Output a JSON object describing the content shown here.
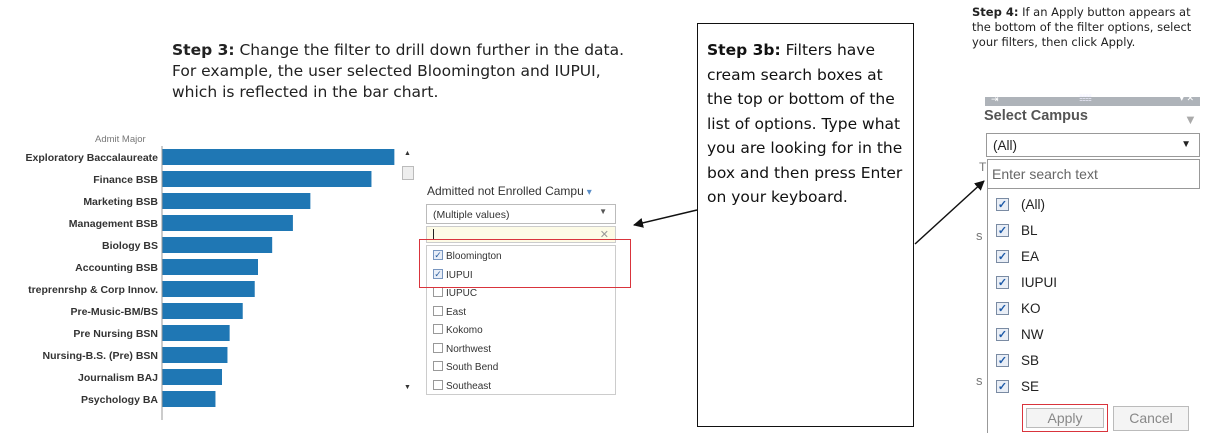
{
  "step3": {
    "label": "Step 3:",
    "text": " Change the filter to drill down further in the data.  For example, the user selected Bloomington and IUPUI, which is reflected in the bar chart."
  },
  "chart_data": {
    "type": "bar",
    "orientation": "horizontal",
    "title": "",
    "xlabel": "",
    "ylabel": "Admit Major",
    "categories": [
      "Exploratory Baccalaureate",
      "Finance BSB",
      "Marketing BSB",
      "Management BSB",
      "Biology BS",
      "Accounting BSB",
      "treprenrshp & Corp Innov.",
      "Pre-Music-BM/BS",
      "Pre Nursing BSN",
      "Nursing-B.S. (Pre) BSN",
      "Journalism BAJ",
      "Psychology BA"
    ],
    "values": [
      2130,
      1920,
      1360,
      1200,
      1010,
      880,
      850,
      740,
      620,
      600,
      550,
      490
    ],
    "xlim": [
      0,
      2200
    ],
    "xticks": [
      "0",
      "500",
      "1000",
      "1500",
      "2000"
    ],
    "bar_color": "#1f77b4",
    "grid": false
  },
  "filter": {
    "title": "Admitted not Enrolled Campu",
    "caret": "▾",
    "select_value": "(Multiple values)",
    "search_close": "✕",
    "items": [
      {
        "label": "Bloomington",
        "checked": true
      },
      {
        "label": "IUPUI",
        "checked": true
      },
      {
        "label": "IUPUC",
        "checked": false
      },
      {
        "label": "East",
        "checked": false
      },
      {
        "label": "Kokomo",
        "checked": false
      },
      {
        "label": "Northwest",
        "checked": false
      },
      {
        "label": "South Bend",
        "checked": false
      },
      {
        "label": "Southeast",
        "checked": false
      }
    ],
    "highlight_color": "#d9343c"
  },
  "step3b": {
    "label": "Step 3b:",
    "text": " Filters have cream search boxes at the top or bottom of the list of options.  Type what you are looking for in the box and then press Enter on your keyboard."
  },
  "step4": {
    "label": "Step 4:",
    "text": " If an Apply button appears at the bottom of the filter options, select your filters, then click Apply."
  },
  "right_panel": {
    "title": "Select Campus",
    "select_value": "(All)",
    "search_placeholder": "Enter search text",
    "items": [
      {
        "label": "(All)",
        "checked": true
      },
      {
        "label": "BL",
        "checked": true
      },
      {
        "label": "EA",
        "checked": true
      },
      {
        "label": "IUPUI",
        "checked": true
      },
      {
        "label": "KO",
        "checked": true
      },
      {
        "label": "NW",
        "checked": true
      },
      {
        "label": "SB",
        "checked": true
      },
      {
        "label": "SE",
        "checked": true
      }
    ],
    "apply_label": "Apply",
    "cancel_label": "Cancel"
  },
  "icons": {
    "pin": "pin-icon",
    "funnel": "funnel-icon",
    "checkmark": "checkmark-icon",
    "dropdown": "chevron-down-icon",
    "close": "close-icon"
  }
}
